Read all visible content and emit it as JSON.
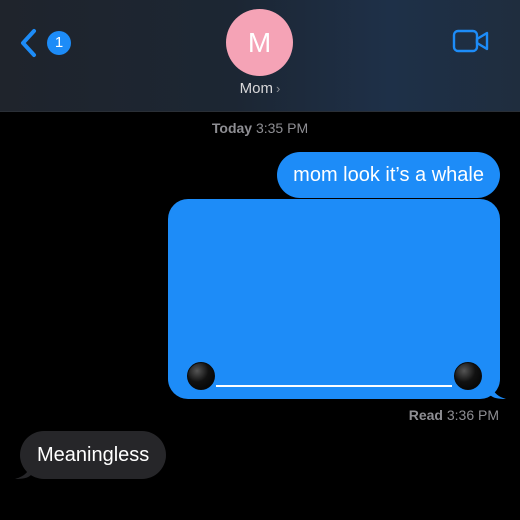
{
  "header": {
    "back_badge_count": "1",
    "back_icon": "chevron-left-icon",
    "avatar_initial": "M",
    "avatar_color": "#f5a3b6",
    "contact_name": "Mom",
    "contact_chevron": "›",
    "video_icon": "video-camera-icon",
    "accent_color": "#1d8cf8"
  },
  "conversation": {
    "timestamp_day": "Today",
    "timestamp_time": "3:35 PM",
    "messages": [
      {
        "direction": "outgoing",
        "type": "text",
        "text": "mom look it’s a whale"
      },
      {
        "direction": "outgoing",
        "type": "media",
        "media_description": "blue media bubble with scrubber line"
      },
      {
        "direction": "incoming",
        "type": "text",
        "text": "Meaningless"
      }
    ],
    "read_label": "Read",
    "read_time": "3:36 PM",
    "outgoing_color": "#1d8cf8",
    "incoming_color": "#262629"
  }
}
